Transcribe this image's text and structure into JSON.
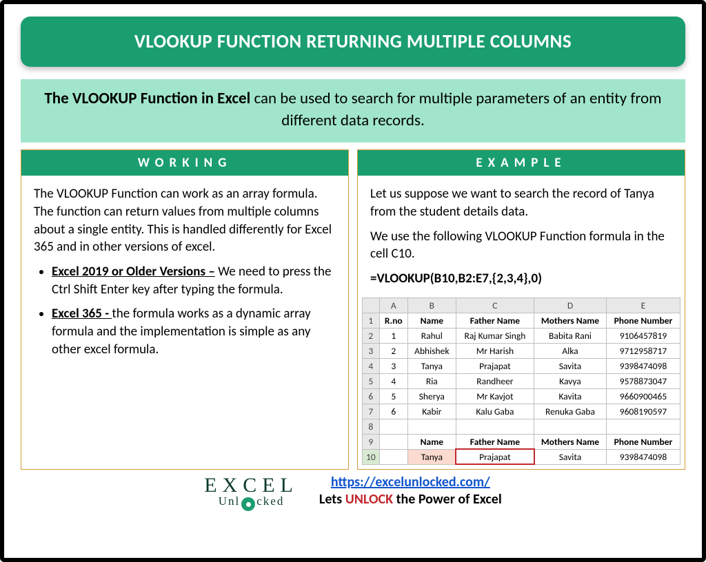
{
  "title": "VLOOKUP FUNCTION RETURNING MULTIPLE COLUMNS",
  "intro": {
    "bold": "The VLOOKUP Function in Excel",
    "rest": " can be used to search for multiple parameters of an entity from different data records."
  },
  "working": {
    "heading": "WORKING",
    "para": "The VLOOKUP Function can work as an array formula. The function can return values from multiple columns about a single entity. This is handled differently for Excel 365 and in other versions of excel.",
    "bullets": [
      {
        "label": "Excel 2019 or Older Versions –",
        "text": " We need to press the Ctrl Shift Enter key after typing the formula."
      },
      {
        "label": "Excel 365 - ",
        "text": " the formula works as a dynamic array formula and the implementation is simple as any other excel formula."
      }
    ]
  },
  "example": {
    "heading": "EXAMPLE",
    "para1": "Let us suppose we want to search the record of Tanya from the student details data.",
    "para2": "We use the following VLOOKUP Function formula in the cell C10.",
    "formula": "=VLOOKUP(B10,B2:E7,{2,3,4},0)"
  },
  "sheet": {
    "cols": [
      "A",
      "B",
      "C",
      "D",
      "E"
    ],
    "headers": [
      "R.no",
      "Name",
      "Father Name",
      "Mothers Name",
      "Phone Number"
    ],
    "rows": [
      [
        "1",
        "Rahul",
        "Raj Kumar Singh",
        "Babita Rani",
        "9106457819"
      ],
      [
        "2",
        "Abhishek",
        "Mr Harish",
        "Alka",
        "9712958717"
      ],
      [
        "3",
        "Tanya",
        "Prajapat",
        "Savita",
        "9398474098"
      ],
      [
        "4",
        "Ria",
        "Randheer",
        "Kavya",
        "9578873047"
      ],
      [
        "5",
        "Sherya",
        "Mr Kavjot",
        "Kavita",
        "9660900465"
      ],
      [
        "6",
        "Kabir",
        "Kalu Gaba",
        "Renuka Gaba",
        "9608190597"
      ]
    ],
    "lookupHeaders": [
      "Name",
      "Father Name",
      "Mothers Name",
      "Phone Number"
    ],
    "lookupRow": [
      "Tanya",
      "Prajapat",
      "Savita",
      "9398474098"
    ]
  },
  "footer": {
    "logo_top": "EXCEL",
    "logo_bottom": "Unl   cked",
    "url": "https://excelunlocked.com/",
    "tagline_pre": "Lets ",
    "tagline_unlock": "UNLOCK",
    "tagline_post": " the Power of Excel"
  }
}
